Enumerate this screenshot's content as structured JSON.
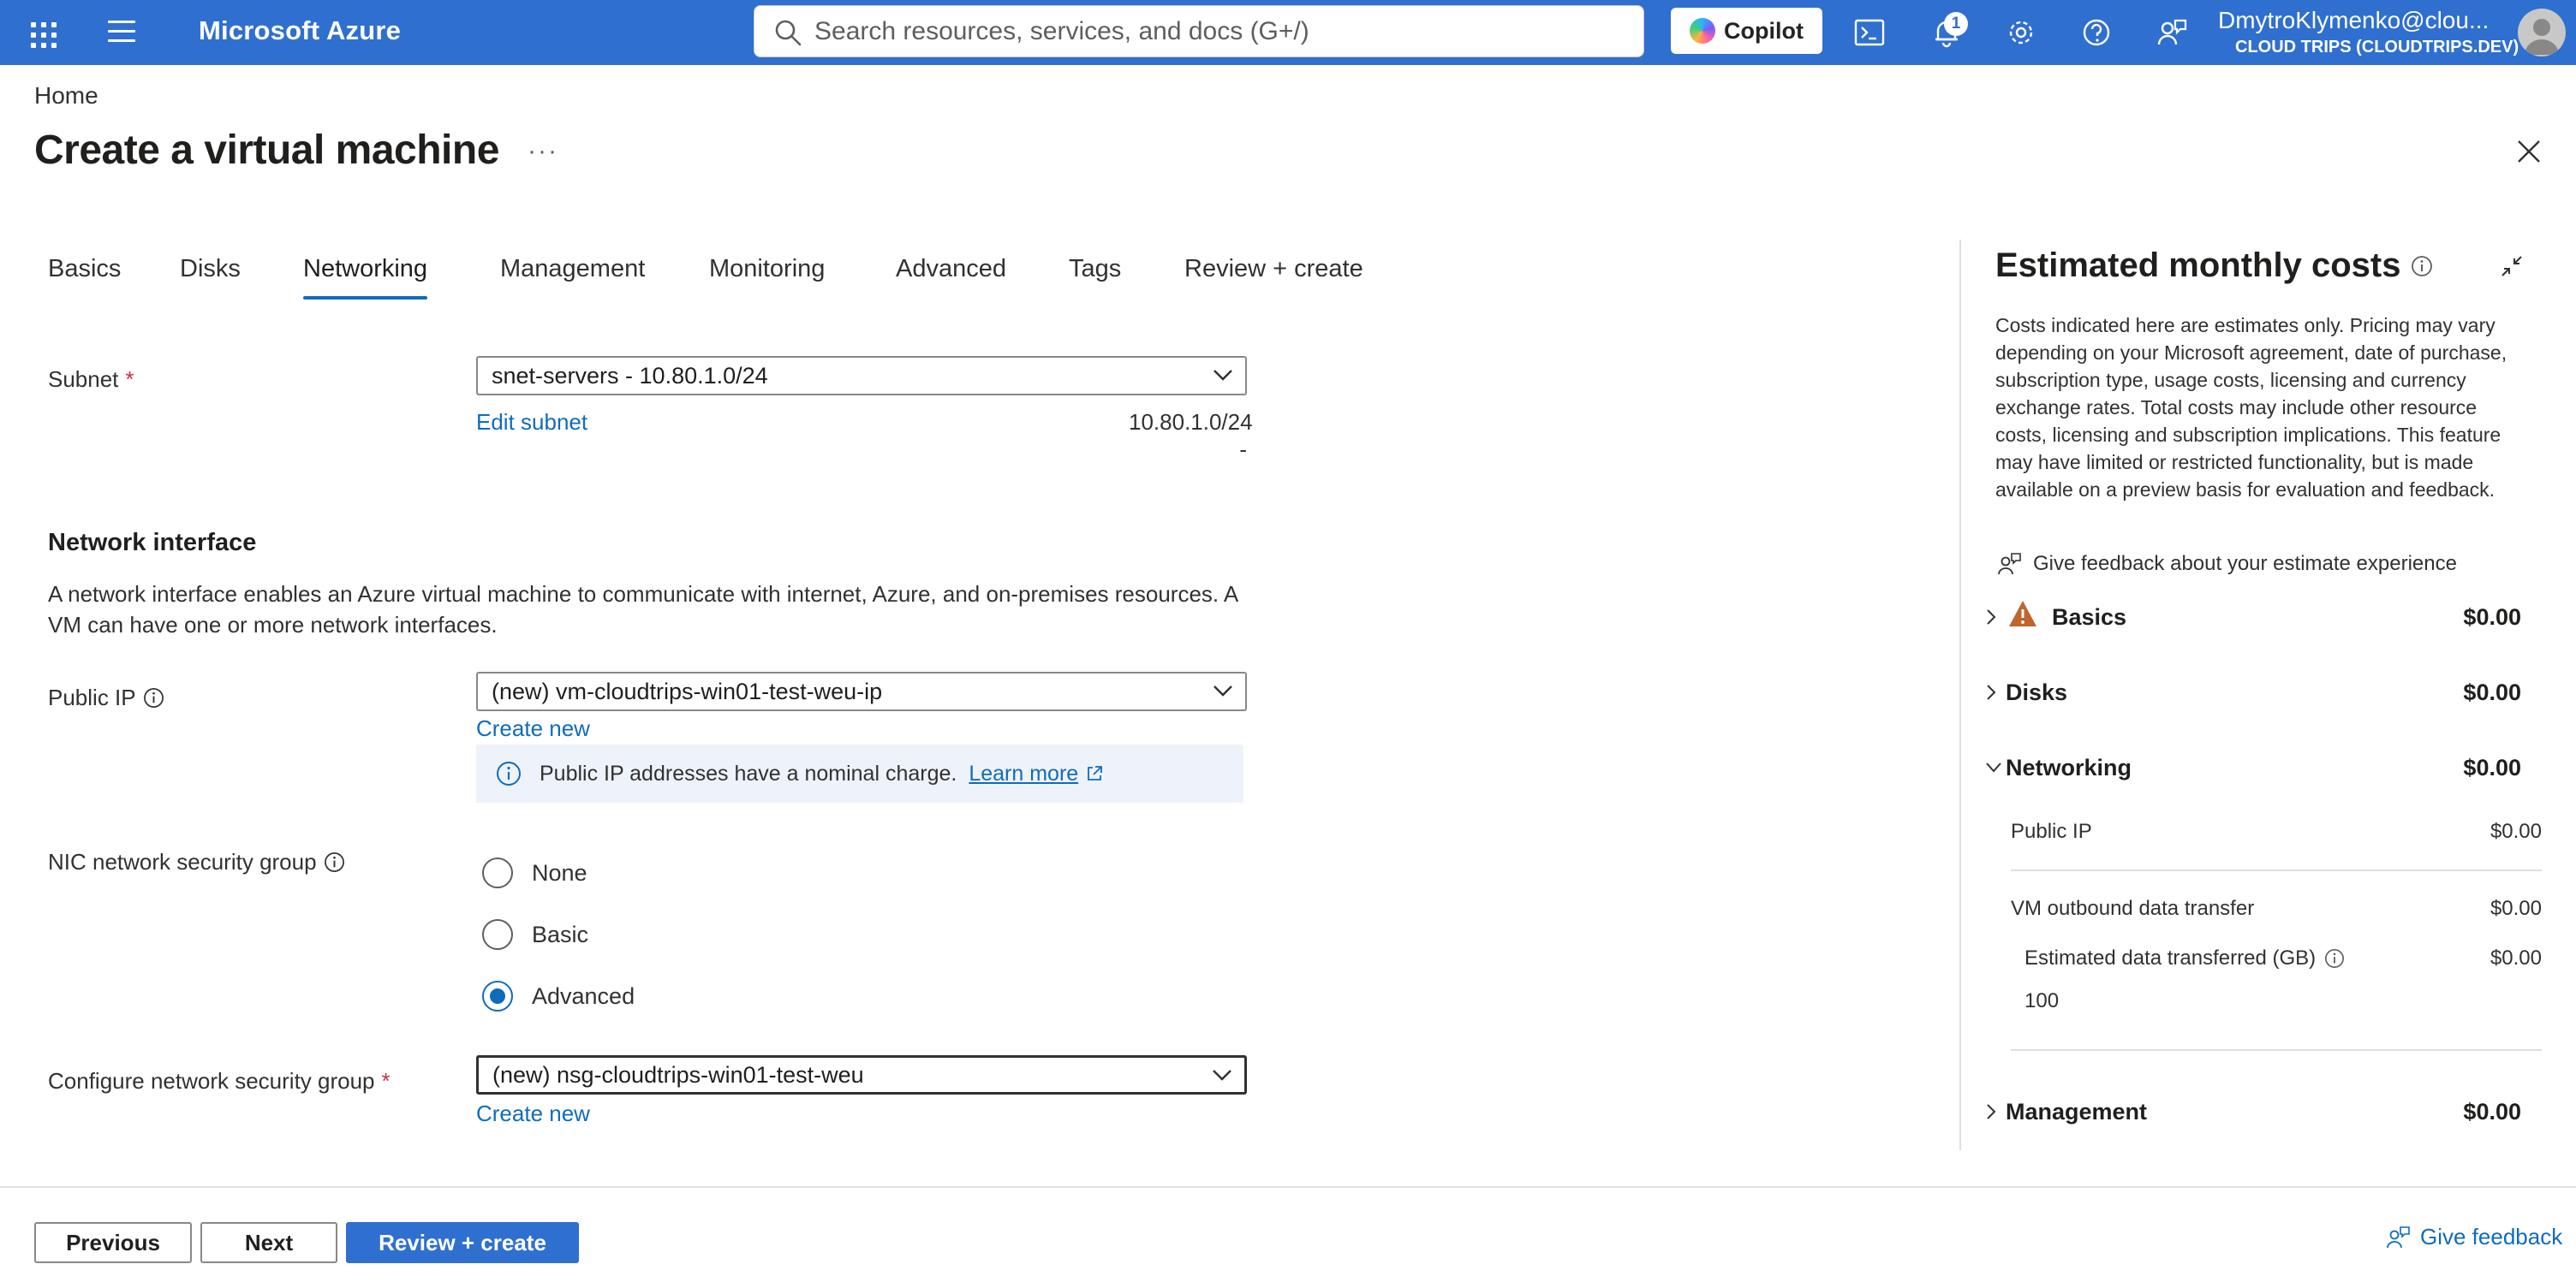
{
  "topbar": {
    "brand": "Microsoft Azure",
    "search_placeholder": "Search resources, services, and docs (G+/)",
    "copilot_label": "Copilot",
    "notification_count": "1",
    "account_name": "DmytroKlymenko@clou...",
    "account_org": "CLOUD TRIPS (CLOUDTRIPS.DEV)",
    "color": "#2f6fcf"
  },
  "page": {
    "breadcrumb": "Home",
    "title": "Create a virtual machine",
    "more": "···"
  },
  "tabs": [
    {
      "label": "Basics",
      "active": false
    },
    {
      "label": "Disks",
      "active": false
    },
    {
      "label": "Networking",
      "active": true
    },
    {
      "label": "Management",
      "active": false
    },
    {
      "label": "Monitoring",
      "active": false
    },
    {
      "label": "Advanced",
      "active": false
    },
    {
      "label": "Tags",
      "active": false
    },
    {
      "label": "Review + create",
      "active": false
    }
  ],
  "form": {
    "subnet": {
      "label": "Subnet",
      "required": "*",
      "value": "snet-servers - 10.80.1.0/24",
      "edit_link": "Edit subnet",
      "range": "10.80.1.0/24",
      "range_dash": "-"
    },
    "network_interface": {
      "heading": "Network interface",
      "description": "A network interface enables an Azure virtual machine to communicate with internet, Azure, and on-premises resources. A VM can have one or more network interfaces."
    },
    "public_ip": {
      "label": "Public IP",
      "value": "(new) vm-cloudtrips-win01-test-weu-ip",
      "create_new": "Create new",
      "info_text": "Public IP addresses have a nominal charge.",
      "learn_more": "Learn more"
    },
    "nic_nsg": {
      "label": "NIC network security group",
      "options": [
        "None",
        "Basic",
        "Advanced"
      ],
      "selected": "Advanced"
    },
    "configure_nsg": {
      "label": "Configure network security group",
      "required": "*",
      "value": "(new) nsg-cloudtrips-win01-test-weu",
      "create_new": "Create new"
    }
  },
  "costs": {
    "title": "Estimated monthly costs",
    "disclaimer": "Costs indicated here are estimates only. Pricing may vary depending on your Microsoft agreement, date of purchase, subscription type, usage costs, licensing and currency exchange rates. Total costs may include other resource costs, licensing and subscription implications. This feature may have limited or restricted functionality, but is made available on a preview basis for evaluation and feedback.",
    "feedback": "Give feedback about your estimate experience",
    "sections": [
      {
        "label": "Basics",
        "amount": "$0.00",
        "expanded": false,
        "warning": true
      },
      {
        "label": "Disks",
        "amount": "$0.00",
        "expanded": false,
        "warning": false
      },
      {
        "label": "Networking",
        "amount": "$0.00",
        "expanded": true,
        "warning": false
      },
      {
        "label": "Management",
        "amount": "$0.00",
        "expanded": false,
        "warning": false
      }
    ],
    "networking_items": {
      "public_ip": {
        "label": "Public IP",
        "amount": "$0.00"
      },
      "outbound": {
        "label": "VM outbound data transfer",
        "amount": "$0.00"
      },
      "estimated": {
        "label": "Estimated data transferred (GB)",
        "amount": "$0.00",
        "value": "100"
      }
    }
  },
  "footer": {
    "previous": "Previous",
    "next": "Next",
    "review_create": "Review + create",
    "give_feedback": "Give feedback"
  }
}
